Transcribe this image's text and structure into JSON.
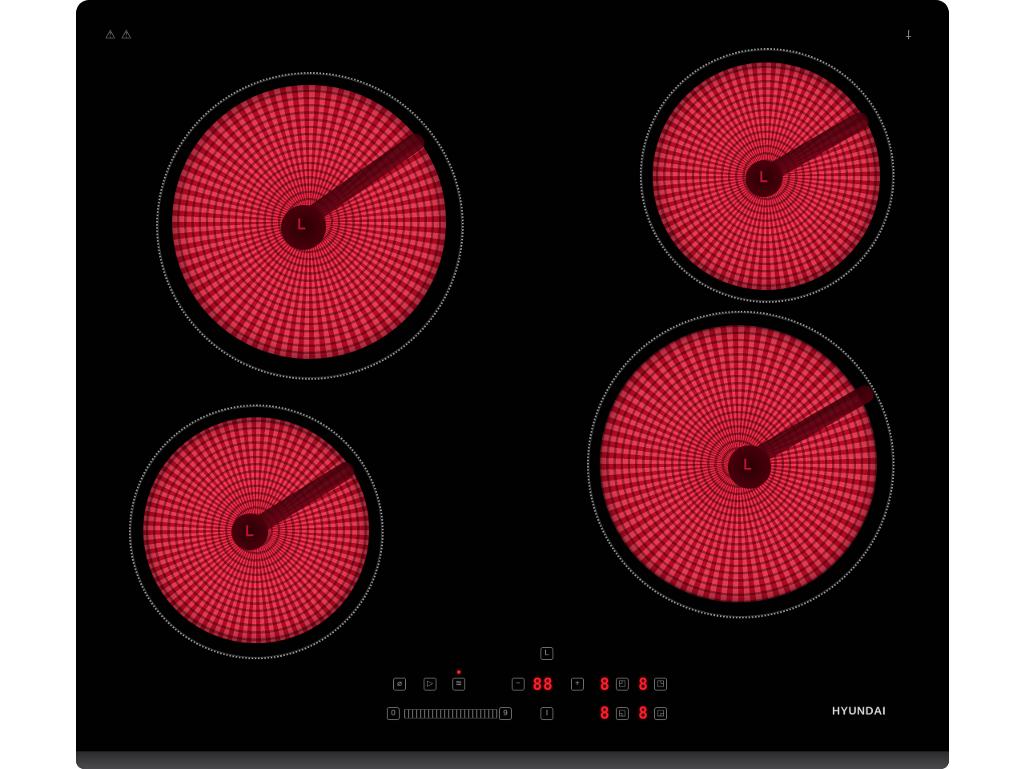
{
  "brand": {
    "name": "HYUNDAI"
  },
  "colors": {
    "glass": "#010101",
    "heat_red": "#d81a3a",
    "display_red": "#ff1f2d",
    "control_gray": "#9a9a9a"
  },
  "icons": {
    "warning_hot": "hot-surface-warning-icon",
    "warning_general": "caution-warning-icon",
    "brand_mark": "brand-mark-icon"
  },
  "controls": {
    "row_top": {
      "timer_symbol": "L",
      "lock_symbol": "⌀",
      "pause_symbol": "▷",
      "keep_warm_symbol": "≋",
      "minus_symbol": "−",
      "plus_symbol": "+",
      "timer_digits": "88",
      "zone_rear_left_digit": "8",
      "zone_rear_right_digit": "8"
    },
    "row_bottom": {
      "slider_min": "0",
      "slider_max": "9",
      "power_symbol": "I",
      "zone_front_left_digit": "8",
      "zone_front_right_digit": "8"
    }
  }
}
